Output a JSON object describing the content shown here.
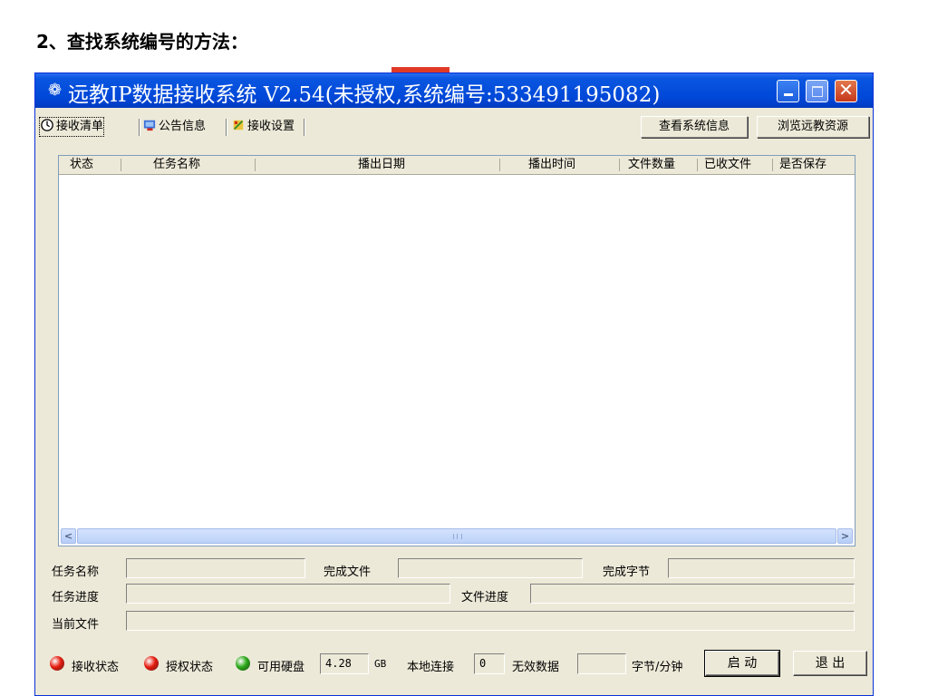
{
  "doc": {
    "heading": "2、查找系统编号的方法："
  },
  "window": {
    "title": "远教IP数据接收系统 V2.54(未授权,系统编号:533491195082)",
    "app_icon": "app-icon",
    "controls": {
      "minimize_icon": "minimize-icon",
      "maximize_icon": "maximize-icon",
      "close_icon": "close-icon"
    }
  },
  "tabs": [
    {
      "label": "接收清单",
      "icon": "clock-icon",
      "active": true
    },
    {
      "label": "公告信息",
      "icon": "bulletin-icon"
    },
    {
      "label": "接收设置",
      "icon": "settings-icon"
    }
  ],
  "toolbar": {
    "view_system_info": "查看系统信息",
    "browse_resources": "浏览远教资源"
  },
  "list": {
    "columns": [
      "状态",
      "任务名称",
      "播出日期",
      "播出时间",
      "文件数量",
      "已收文件",
      "是否保存"
    ],
    "rows": []
  },
  "info": {
    "task_name_label": "任务名称",
    "done_files_label": "完成文件",
    "done_bytes_label": "完成字节",
    "task_progress_label": "任务进度",
    "file_progress_label": "文件进度",
    "current_file_label": "当前文件"
  },
  "status": {
    "receive_state": "接收状态",
    "receive_state_color": "#e51c10",
    "auth_state": "授权状态",
    "auth_state_color": "#e51c10",
    "disk_label": "可用硬盘",
    "disk_value": "4.28",
    "disk_unit": "GB",
    "disk_state_color": "#2aa818",
    "local_conn_label": "本地连接",
    "local_conn_value": "0",
    "invalid_data_label": "无效数据",
    "invalid_data_value": "",
    "rate_unit": "字节/分钟",
    "start_button": "启 动",
    "exit_button": "退 出"
  }
}
